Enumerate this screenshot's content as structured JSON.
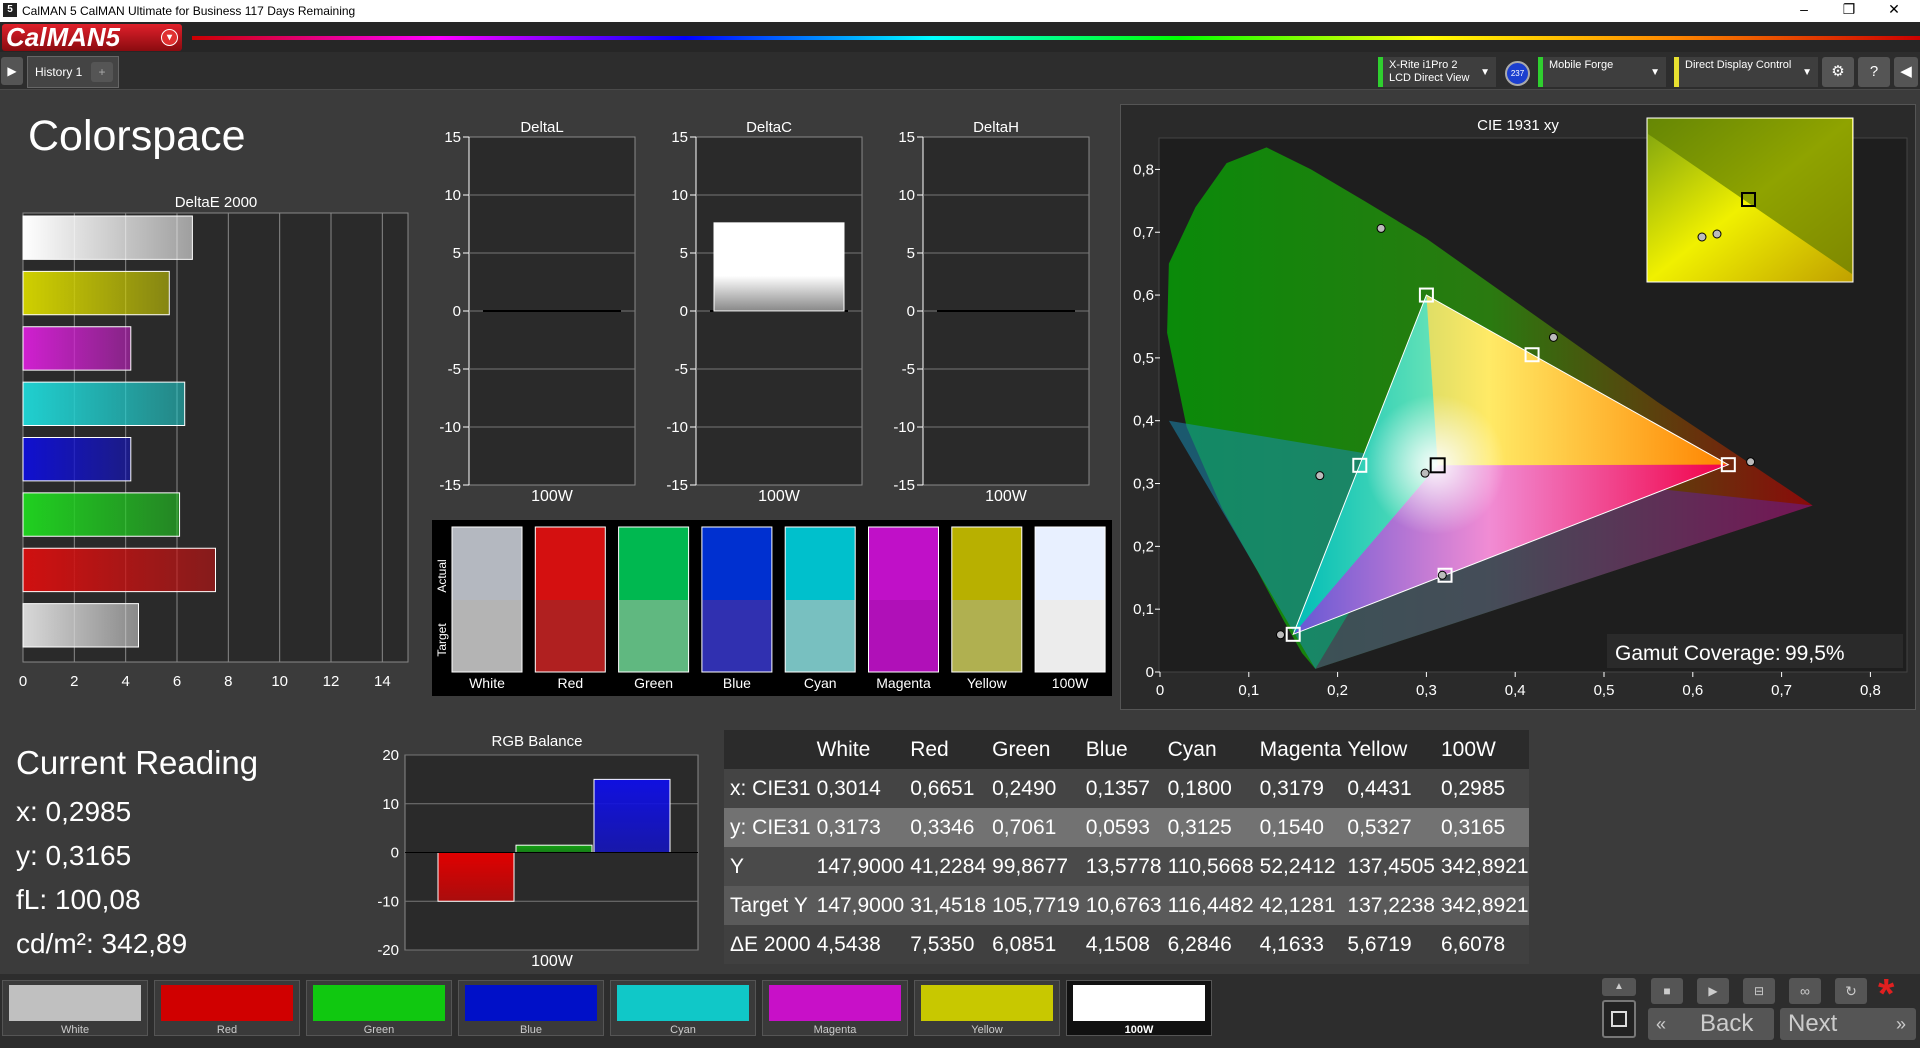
{
  "app": {
    "window_title": "CalMAN 5 CalMAN Ultimate for Business 117 Days Remaining",
    "logo": "CalMAN5",
    "tab_label": "History 1",
    "devices": [
      {
        "name": "X-Rite i1Pro 2",
        "sub": "LCD Direct View",
        "color": "#2fcf2f"
      },
      {
        "name": "Mobile Forge",
        "sub": "",
        "color": "#2fcf2f"
      },
      {
        "name": "Direct Display Control",
        "sub": "",
        "color": "#e8e030"
      }
    ],
    "badge": "237"
  },
  "page": {
    "title": "Colorspace"
  },
  "deltae": {
    "title": "DeltaE 2000",
    "ticks": [
      "0",
      "2",
      "4",
      "6",
      "8",
      "10",
      "12",
      "14"
    ],
    "bars": [
      {
        "name": "White",
        "value": 6.6,
        "color": "#ffffff"
      },
      {
        "name": "Yellow",
        "value": 5.7,
        "color": "#d0d000"
      },
      {
        "name": "Magenta",
        "value": 4.2,
        "color": "#d020d0"
      },
      {
        "name": "Cyan",
        "value": 6.3,
        "color": "#20d0d0"
      },
      {
        "name": "Blue",
        "value": 4.2,
        "color": "#1010d0"
      },
      {
        "name": "Green",
        "value": 6.1,
        "color": "#20d020"
      },
      {
        "name": "Red",
        "value": 7.5,
        "color": "#d01010"
      },
      {
        "name": "100W",
        "value": 4.5,
        "color": "#d8d8d8"
      }
    ]
  },
  "deltas": [
    {
      "title": "DeltaL",
      "label": "100W",
      "value": 0
    },
    {
      "title": "DeltaC",
      "label": "100W",
      "value": 7.6
    },
    {
      "title": "DeltaH",
      "label": "100W",
      "value": 0
    }
  ],
  "delta_ticks": [
    "15",
    "10",
    "5",
    "0",
    "-5",
    "-10",
    "-15"
  ],
  "swatches": {
    "actual_label": "Actual",
    "target_label": "Target",
    "items": [
      {
        "name": "White",
        "actual": "#b4b8c0",
        "target": "#b4b4b4"
      },
      {
        "name": "Red",
        "actual": "#d41010",
        "target": "#b02020"
      },
      {
        "name": "Green",
        "actual": "#00b850",
        "target": "#60b880"
      },
      {
        "name": "Blue",
        "actual": "#0030d0",
        "target": "#3030b0"
      },
      {
        "name": "Cyan",
        "actual": "#00c0cc",
        "target": "#78c0c0"
      },
      {
        "name": "Magenta",
        "actual": "#c010c8",
        "target": "#b010b8"
      },
      {
        "name": "Yellow",
        "actual": "#b8b000",
        "target": "#b0b050"
      },
      {
        "name": "100W",
        "actual": "#e8f0ff",
        "target": "#ececec"
      }
    ]
  },
  "cie": {
    "title": "CIE 1931 xy",
    "x_ticks": [
      "0",
      "0,1",
      "0,2",
      "0,3",
      "0,4",
      "0,5",
      "0,6",
      "0,7",
      "0,8"
    ],
    "y_ticks": [
      "0",
      "0,1",
      "0,2",
      "0,3",
      "0,4",
      "0,5",
      "0,6",
      "0,7",
      "0,8"
    ],
    "gamut_label": "Gamut Coverage:",
    "gamut_value": "99,5%",
    "targets": [
      [
        0.64,
        0.33
      ],
      [
        0.3,
        0.6
      ],
      [
        0.15,
        0.06
      ],
      [
        0.225,
        0.329
      ],
      [
        0.321,
        0.154
      ],
      [
        0.419,
        0.505
      ],
      [
        0.3127,
        0.329
      ]
    ],
    "measured": [
      [
        0.6651,
        0.3346
      ],
      [
        0.249,
        0.7061
      ],
      [
        0.1357,
        0.0593
      ],
      [
        0.18,
        0.3125
      ],
      [
        0.3179,
        0.154
      ],
      [
        0.4431,
        0.5327
      ],
      [
        0.2985,
        0.3165
      ]
    ]
  },
  "reading": {
    "title": "Current Reading",
    "lines": [
      "x: 0,2985",
      "y: 0,3165",
      "fL: 100,08",
      "cd/m²: 342,89"
    ]
  },
  "rgb_balance": {
    "title": "RGB Balance",
    "label": "100W",
    "ticks": [
      "20",
      "10",
      "0",
      "-10",
      "-20"
    ],
    "values": [
      {
        "name": "R",
        "value": -10,
        "color": "#e00000"
      },
      {
        "name": "G",
        "value": 1.5,
        "color": "#10a010"
      },
      {
        "name": "B",
        "value": 15,
        "color": "#1010e0"
      }
    ]
  },
  "table": {
    "headers": [
      "",
      "White",
      "Red",
      "Green",
      "Blue",
      "Cyan",
      "Magenta",
      "Yellow",
      "100W"
    ],
    "rows": [
      [
        "x: CIE31",
        "0,3014",
        "0,6651",
        "0,2490",
        "0,1357",
        "0,1800",
        "0,3179",
        "0,4431",
        "0,2985"
      ],
      [
        "y: CIE31",
        "0,3173",
        "0,3346",
        "0,7061",
        "0,0593",
        "0,3125",
        "0,1540",
        "0,5327",
        "0,3165"
      ],
      [
        "Y",
        "147,9000",
        "41,2284",
        "99,8677",
        "13,5778",
        "110,5668",
        "52,2412",
        "137,4505",
        "342,8921"
      ],
      [
        "Target Y",
        "147,9000",
        "31,4518",
        "105,7719",
        "10,6763",
        "116,4482",
        "42,1281",
        "137,2238",
        "342,8921"
      ],
      [
        "ΔE 2000",
        "4,5438",
        "7,5350",
        "6,0851",
        "4,1508",
        "6,2846",
        "4,1633",
        "5,6719",
        "6,6078"
      ]
    ]
  },
  "bottom_swatches": [
    {
      "name": "White",
      "color": "#c0c0c0",
      "selected": false
    },
    {
      "name": "Red",
      "color": "#d00000",
      "selected": false
    },
    {
      "name": "Green",
      "color": "#10c810",
      "selected": false
    },
    {
      "name": "Blue",
      "color": "#0010c8",
      "selected": false
    },
    {
      "name": "Cyan",
      "color": "#10c8c8",
      "selected": false
    },
    {
      "name": "Magenta",
      "color": "#c810c8",
      "selected": false
    },
    {
      "name": "Yellow",
      "color": "#c8c800",
      "selected": false
    },
    {
      "name": "100W",
      "color": "#ffffff",
      "selected": true
    }
  ],
  "nav": {
    "back": "Back",
    "next": "Next"
  }
}
